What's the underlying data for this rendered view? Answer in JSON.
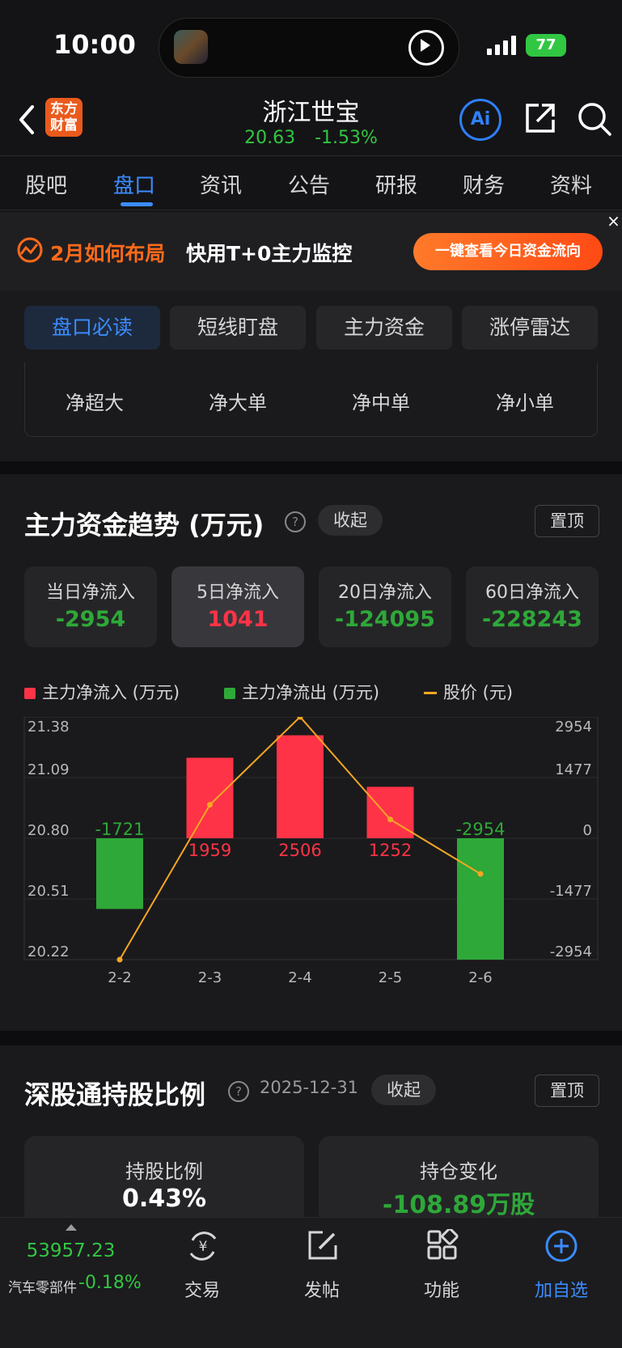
{
  "status_bar": {
    "time": "10:00",
    "battery": "77"
  },
  "header": {
    "logo_text": "东方财富",
    "stock_name": "浙江世宝",
    "price": "20.63",
    "change_pct": "-1.53%",
    "ai_label": "Ai"
  },
  "tabs": [
    {
      "label": "股吧"
    },
    {
      "label": "盘口"
    },
    {
      "label": "资讯"
    },
    {
      "label": "公告"
    },
    {
      "label": "研报"
    },
    {
      "label": "财务"
    },
    {
      "label": "资料"
    }
  ],
  "banner": {
    "text_orange": "2月如何布局",
    "text_white": "快用T+0主力监控",
    "button": "一键查看今日资金流向",
    "close": "×"
  },
  "sub_tabs": [
    {
      "label": "盘口必读"
    },
    {
      "label": "短线盯盘"
    },
    {
      "label": "主力资金"
    },
    {
      "label": "涨停雷达"
    }
  ],
  "flow_labels": [
    {
      "label": "净超大"
    },
    {
      "label": "净大单"
    },
    {
      "label": "净中单"
    },
    {
      "label": "净小单"
    }
  ],
  "main_trend": {
    "title": "主力资金趋势 (万元)",
    "help": "?",
    "collapse": "收起",
    "pin": "置顶",
    "stats": [
      {
        "label": "当日净流入",
        "value": "-2954"
      },
      {
        "label": "5日净流入",
        "value": "1041"
      },
      {
        "label": "20日净流入",
        "value": "-124095"
      },
      {
        "label": "60日净流入",
        "value": "-228243"
      }
    ],
    "legend": [
      {
        "label": "主力净流入 (万元)",
        "color": "#ff3347"
      },
      {
        "label": "主力净流出 (万元)",
        "color": "#2ea838"
      },
      {
        "label": "股价 (元)",
        "color": "#f5a623"
      }
    ]
  },
  "chart_data": {
    "type": "bar",
    "categories": [
      "2-2",
      "2-3",
      "2-4",
      "2-5",
      "2-6"
    ],
    "series": [
      {
        "name": "主力净流入 (万元)",
        "values": [
          -1721,
          1959,
          2506,
          1252,
          -2954
        ]
      },
      {
        "name": "股价 (元)",
        "values": [
          20.22,
          20.96,
          21.38,
          20.89,
          20.63
        ]
      }
    ],
    "bar_labels": [
      "-1721",
      "1959",
      "2506",
      "1252",
      "-2954"
    ],
    "left_ticks": [
      "21.38",
      "21.09",
      "20.80",
      "20.51",
      "20.22"
    ],
    "right_ticks": [
      "2954",
      "1477",
      "0",
      "-1477",
      "-2954"
    ],
    "left_ylim": [
      20.22,
      21.38
    ],
    "right_ylim": [
      -2954,
      2954
    ],
    "positive_color": "#ff3347",
    "negative_color": "#2ea838",
    "line_color": "#f5a623"
  },
  "hk_holding": {
    "title": "深股通持股比例",
    "help": "?",
    "date": "2025-12-31",
    "collapse": "收起",
    "pin": "置顶",
    "cards": [
      {
        "label": "持股比例",
        "value": "0.43%"
      },
      {
        "label": "持仓变化",
        "value": "-108.89万股"
      }
    ]
  },
  "bottom_bar": {
    "index_value": "53957.23",
    "index_name": "汽车零部件",
    "index_change": "-0.18%",
    "items": [
      {
        "label": "交易"
      },
      {
        "label": "发帖"
      },
      {
        "label": "功能"
      },
      {
        "label": "加自选"
      }
    ]
  }
}
